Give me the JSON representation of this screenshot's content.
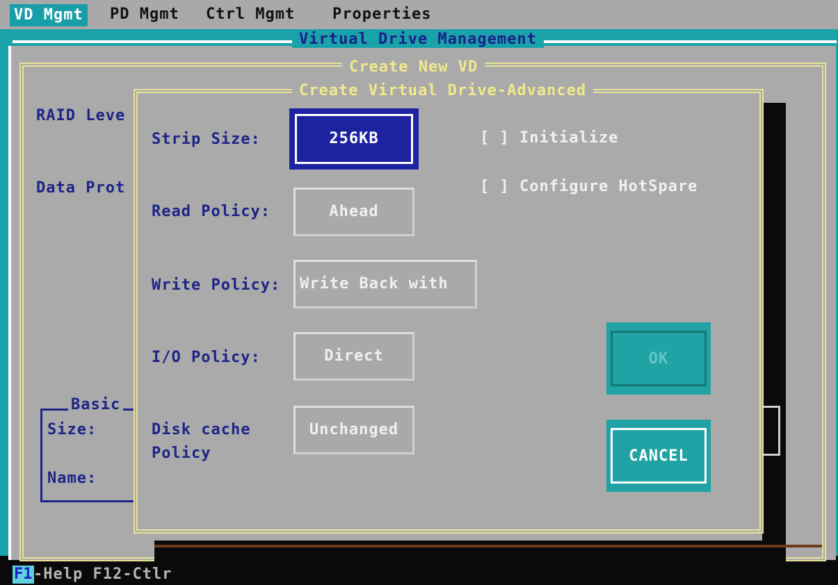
{
  "menu": {
    "items": [
      {
        "label": "VD Mgmt",
        "active": true
      },
      {
        "label": "PD Mgmt",
        "active": false
      },
      {
        "label": "Ctrl Mgmt",
        "active": false
      },
      {
        "label": "Properties",
        "active": false
      }
    ]
  },
  "vd_window": {
    "title": "Virtual Drive Management"
  },
  "create_panel": {
    "title": "Create New VD",
    "raid_level_label": "RAID Leve",
    "data_protection_label": "Data Prot",
    "basic_group": {
      "title": "Basic",
      "size_label": "Size:",
      "name_label": "Name:"
    }
  },
  "advanced_dialog": {
    "title": "Create Virtual Drive-Advanced",
    "fields": {
      "strip_size": {
        "label": "Strip Size:",
        "value": "256KB"
      },
      "read_policy": {
        "label": "Read Policy:",
        "value": "Ahead"
      },
      "write_policy": {
        "label": "Write Policy:",
        "value": "Write Back with"
      },
      "io_policy": {
        "label": "I/O Policy:",
        "value": "Direct"
      },
      "disk_cache_policy": {
        "label_line1": "Disk cache",
        "label_line2": "Policy",
        "value": "Unchanged"
      }
    },
    "checkboxes": {
      "initialize": {
        "label": "[ ] Initialize",
        "checked": false
      },
      "configure_hotspare": {
        "label": "[ ] Configure HotSpare",
        "checked": false
      }
    },
    "buttons": {
      "ok": "OK",
      "cancel": "CANCEL"
    }
  },
  "status_bar": {
    "key": "F1",
    "text": "-Help F12-Ctlr"
  },
  "colors": {
    "teal": "#19a2aa",
    "panel_gray": "#aaaaaa",
    "navy_text": "#1c2487",
    "title_yellow": "#f2e98a",
    "selected_blue": "#1d23a0"
  }
}
